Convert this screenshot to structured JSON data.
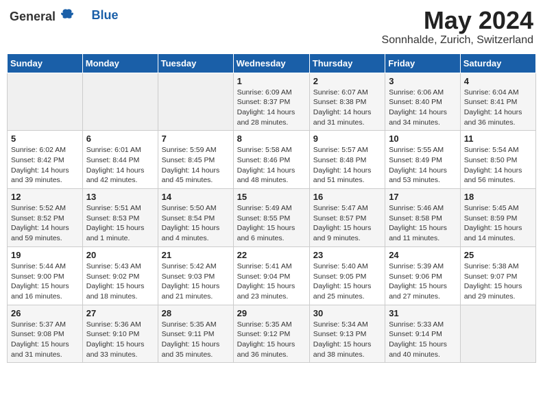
{
  "header": {
    "logo_general": "General",
    "logo_blue": "Blue",
    "month": "May 2024",
    "location": "Sonnhalde, Zurich, Switzerland"
  },
  "weekdays": [
    "Sunday",
    "Monday",
    "Tuesday",
    "Wednesday",
    "Thursday",
    "Friday",
    "Saturday"
  ],
  "weeks": [
    [
      {
        "day": "",
        "detail": ""
      },
      {
        "day": "",
        "detail": ""
      },
      {
        "day": "",
        "detail": ""
      },
      {
        "day": "1",
        "detail": "Sunrise: 6:09 AM\nSunset: 8:37 PM\nDaylight: 14 hours\nand 28 minutes."
      },
      {
        "day": "2",
        "detail": "Sunrise: 6:07 AM\nSunset: 8:38 PM\nDaylight: 14 hours\nand 31 minutes."
      },
      {
        "day": "3",
        "detail": "Sunrise: 6:06 AM\nSunset: 8:40 PM\nDaylight: 14 hours\nand 34 minutes."
      },
      {
        "day": "4",
        "detail": "Sunrise: 6:04 AM\nSunset: 8:41 PM\nDaylight: 14 hours\nand 36 minutes."
      }
    ],
    [
      {
        "day": "5",
        "detail": "Sunrise: 6:02 AM\nSunset: 8:42 PM\nDaylight: 14 hours\nand 39 minutes."
      },
      {
        "day": "6",
        "detail": "Sunrise: 6:01 AM\nSunset: 8:44 PM\nDaylight: 14 hours\nand 42 minutes."
      },
      {
        "day": "7",
        "detail": "Sunrise: 5:59 AM\nSunset: 8:45 PM\nDaylight: 14 hours\nand 45 minutes."
      },
      {
        "day": "8",
        "detail": "Sunrise: 5:58 AM\nSunset: 8:46 PM\nDaylight: 14 hours\nand 48 minutes."
      },
      {
        "day": "9",
        "detail": "Sunrise: 5:57 AM\nSunset: 8:48 PM\nDaylight: 14 hours\nand 51 minutes."
      },
      {
        "day": "10",
        "detail": "Sunrise: 5:55 AM\nSunset: 8:49 PM\nDaylight: 14 hours\nand 53 minutes."
      },
      {
        "day": "11",
        "detail": "Sunrise: 5:54 AM\nSunset: 8:50 PM\nDaylight: 14 hours\nand 56 minutes."
      }
    ],
    [
      {
        "day": "12",
        "detail": "Sunrise: 5:52 AM\nSunset: 8:52 PM\nDaylight: 14 hours\nand 59 minutes."
      },
      {
        "day": "13",
        "detail": "Sunrise: 5:51 AM\nSunset: 8:53 PM\nDaylight: 15 hours\nand 1 minute."
      },
      {
        "day": "14",
        "detail": "Sunrise: 5:50 AM\nSunset: 8:54 PM\nDaylight: 15 hours\nand 4 minutes."
      },
      {
        "day": "15",
        "detail": "Sunrise: 5:49 AM\nSunset: 8:55 PM\nDaylight: 15 hours\nand 6 minutes."
      },
      {
        "day": "16",
        "detail": "Sunrise: 5:47 AM\nSunset: 8:57 PM\nDaylight: 15 hours\nand 9 minutes."
      },
      {
        "day": "17",
        "detail": "Sunrise: 5:46 AM\nSunset: 8:58 PM\nDaylight: 15 hours\nand 11 minutes."
      },
      {
        "day": "18",
        "detail": "Sunrise: 5:45 AM\nSunset: 8:59 PM\nDaylight: 15 hours\nand 14 minutes."
      }
    ],
    [
      {
        "day": "19",
        "detail": "Sunrise: 5:44 AM\nSunset: 9:00 PM\nDaylight: 15 hours\nand 16 minutes."
      },
      {
        "day": "20",
        "detail": "Sunrise: 5:43 AM\nSunset: 9:02 PM\nDaylight: 15 hours\nand 18 minutes."
      },
      {
        "day": "21",
        "detail": "Sunrise: 5:42 AM\nSunset: 9:03 PM\nDaylight: 15 hours\nand 21 minutes."
      },
      {
        "day": "22",
        "detail": "Sunrise: 5:41 AM\nSunset: 9:04 PM\nDaylight: 15 hours\nand 23 minutes."
      },
      {
        "day": "23",
        "detail": "Sunrise: 5:40 AM\nSunset: 9:05 PM\nDaylight: 15 hours\nand 25 minutes."
      },
      {
        "day": "24",
        "detail": "Sunrise: 5:39 AM\nSunset: 9:06 PM\nDaylight: 15 hours\nand 27 minutes."
      },
      {
        "day": "25",
        "detail": "Sunrise: 5:38 AM\nSunset: 9:07 PM\nDaylight: 15 hours\nand 29 minutes."
      }
    ],
    [
      {
        "day": "26",
        "detail": "Sunrise: 5:37 AM\nSunset: 9:08 PM\nDaylight: 15 hours\nand 31 minutes."
      },
      {
        "day": "27",
        "detail": "Sunrise: 5:36 AM\nSunset: 9:10 PM\nDaylight: 15 hours\nand 33 minutes."
      },
      {
        "day": "28",
        "detail": "Sunrise: 5:35 AM\nSunset: 9:11 PM\nDaylight: 15 hours\nand 35 minutes."
      },
      {
        "day": "29",
        "detail": "Sunrise: 5:35 AM\nSunset: 9:12 PM\nDaylight: 15 hours\nand 36 minutes."
      },
      {
        "day": "30",
        "detail": "Sunrise: 5:34 AM\nSunset: 9:13 PM\nDaylight: 15 hours\nand 38 minutes."
      },
      {
        "day": "31",
        "detail": "Sunrise: 5:33 AM\nSunset: 9:14 PM\nDaylight: 15 hours\nand 40 minutes."
      },
      {
        "day": "",
        "detail": ""
      }
    ]
  ]
}
